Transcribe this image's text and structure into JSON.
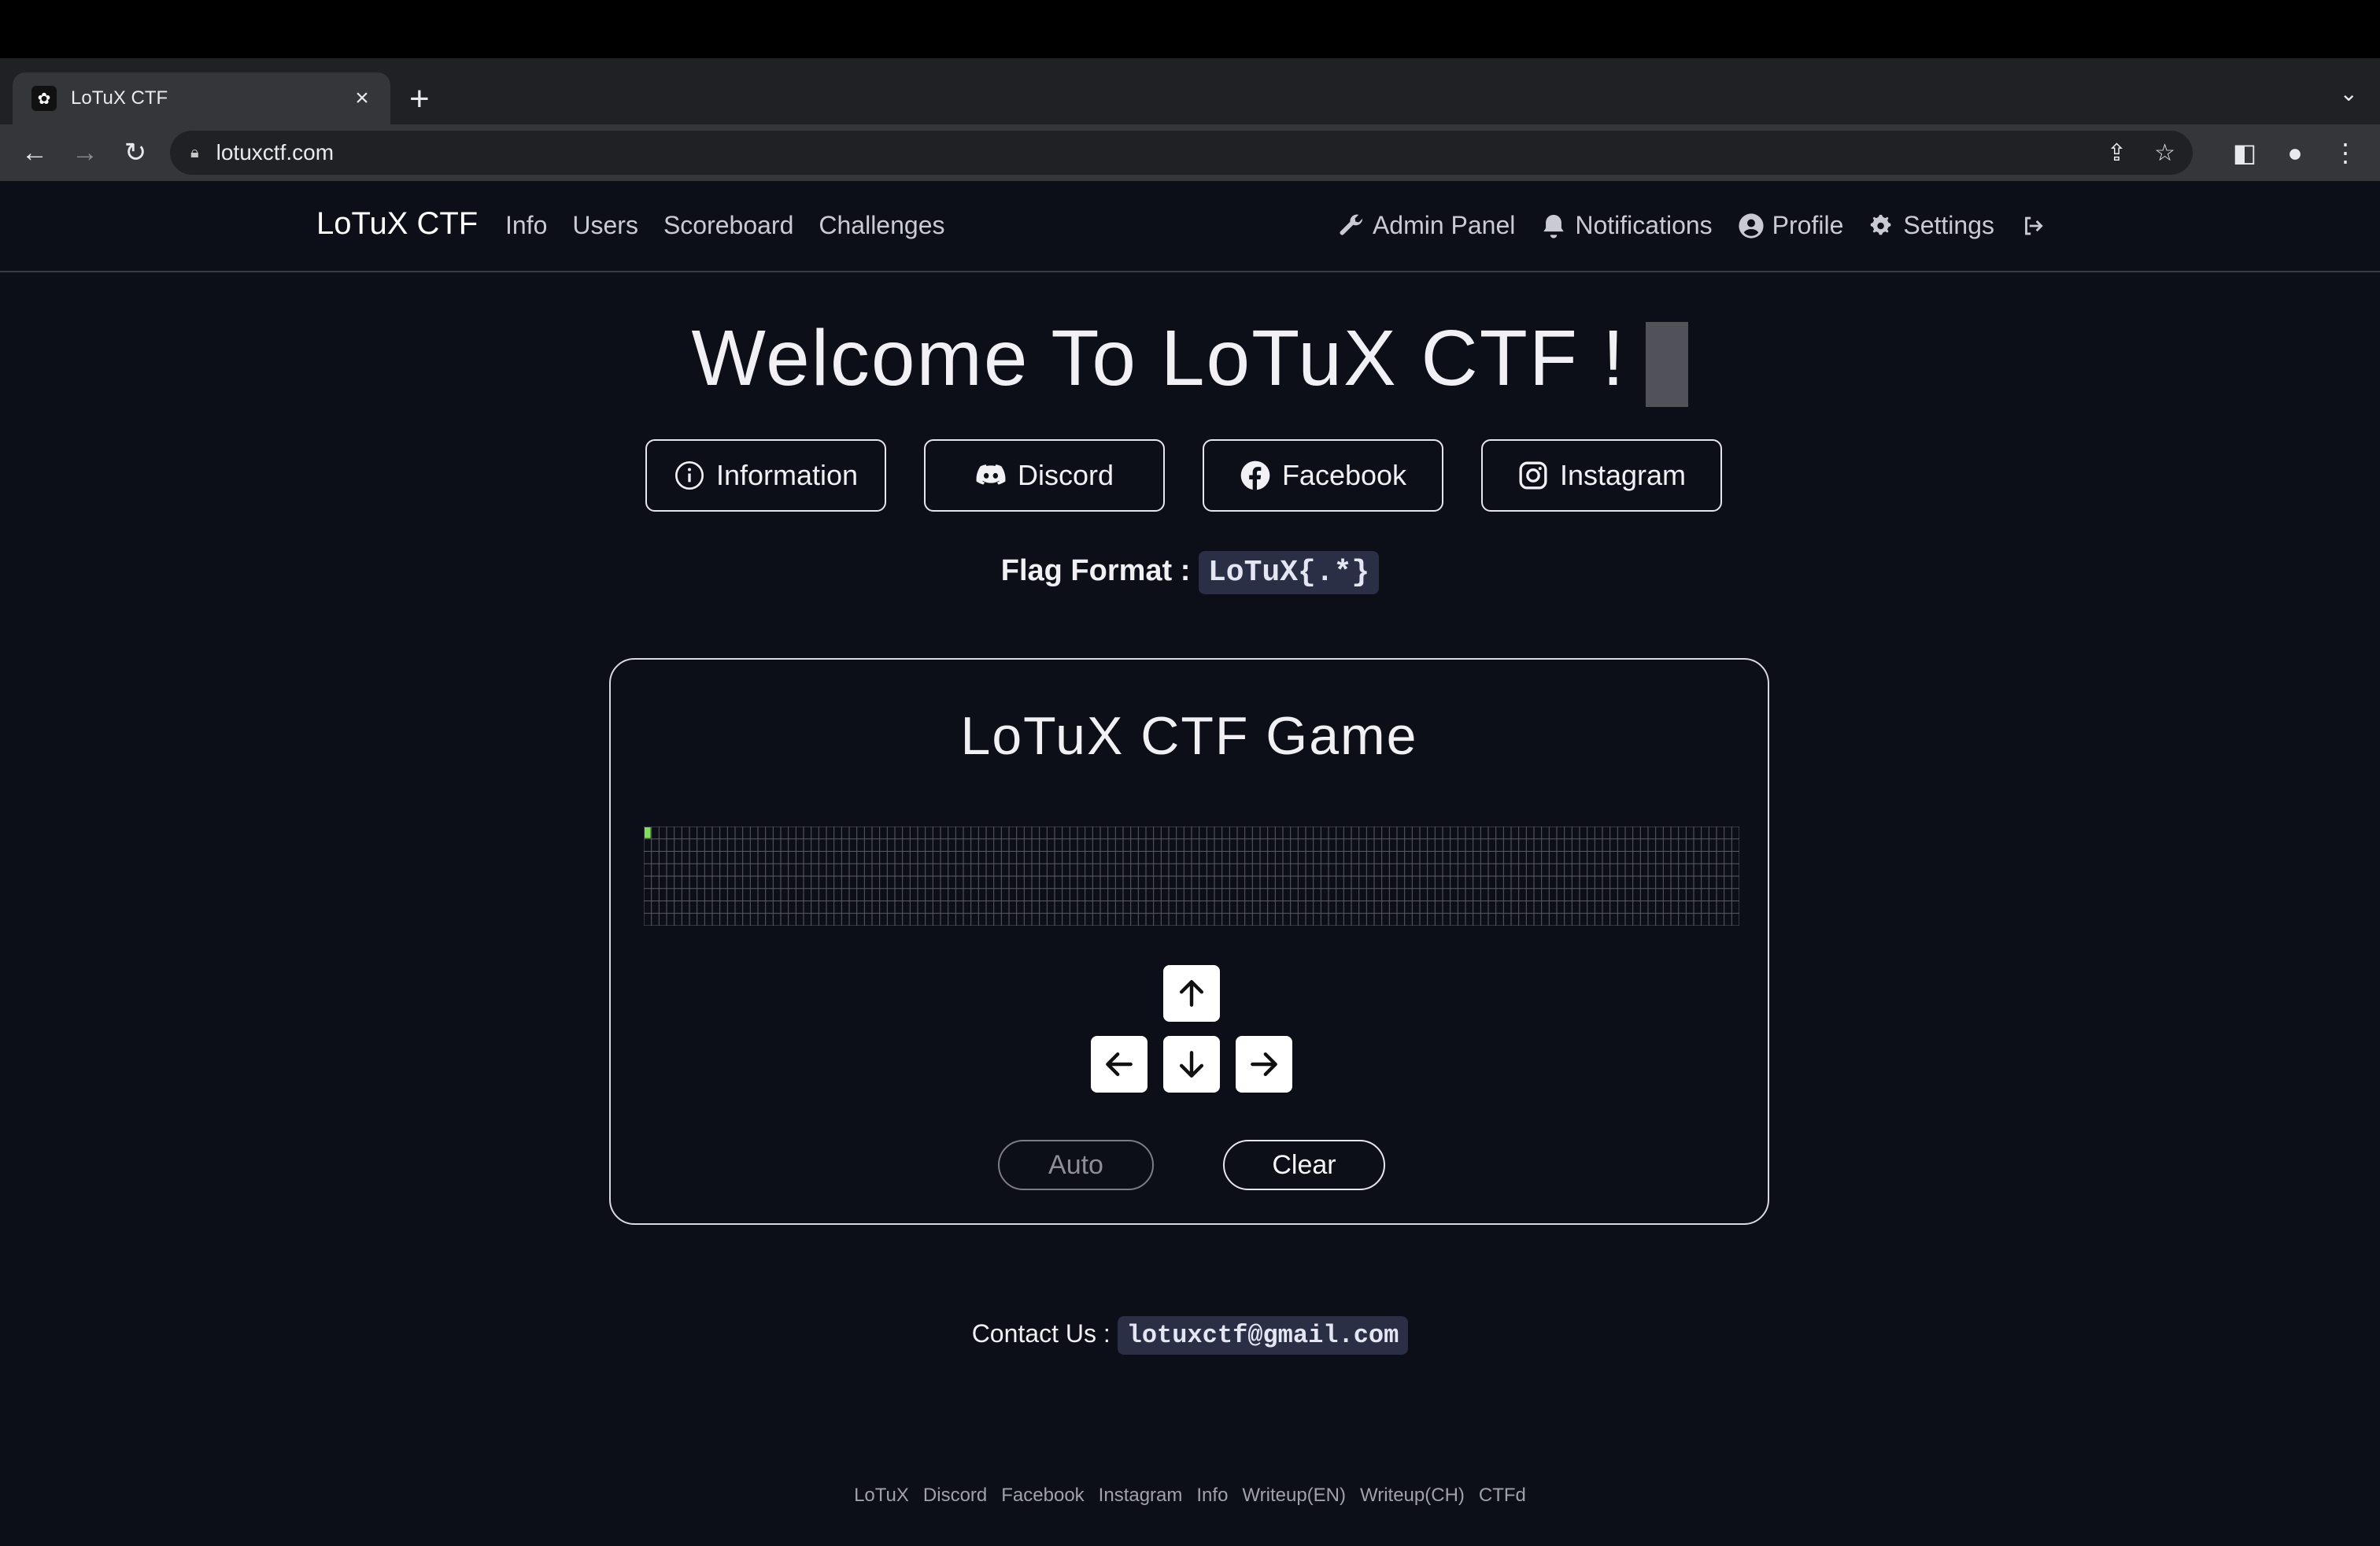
{
  "browser": {
    "tab_title": "LoTuX CTF",
    "url": "lotuxctf.com"
  },
  "navbar": {
    "brand": "LoTuX CTF",
    "links": [
      "Info",
      "Users",
      "Scoreboard",
      "Challenges"
    ],
    "right": {
      "admin": "Admin Panel",
      "notifications": "Notifications",
      "profile": "Profile",
      "settings": "Settings"
    }
  },
  "hero": {
    "title": "Welcome To LoTuX CTF !",
    "buttons": {
      "information": "Information",
      "discord": "Discord",
      "facebook": "Facebook",
      "instagram": "Instagram"
    },
    "flag_label": "Flag Format :",
    "flag_value": "LoTuX{.*}"
  },
  "game": {
    "title": "LoTuX CTF Game",
    "grid": {
      "columns": 144,
      "rows": 8,
      "player_col": 0,
      "player_row": 0
    },
    "auto_label": "Auto",
    "clear_label": "Clear"
  },
  "contact": {
    "label": "Contact Us :",
    "email": "lotuxctf@gmail.com"
  },
  "footer": {
    "links": [
      "LoTuX",
      "Discord",
      "Facebook",
      "Instagram",
      "Info",
      "Writeup(EN)",
      "Writeup(CH)",
      "CTFd"
    ]
  },
  "colors": {
    "background": "#0d0f18",
    "grid_line": "#5a5b63",
    "player": "#7fe05a",
    "code_bg": "#2b2f45"
  }
}
